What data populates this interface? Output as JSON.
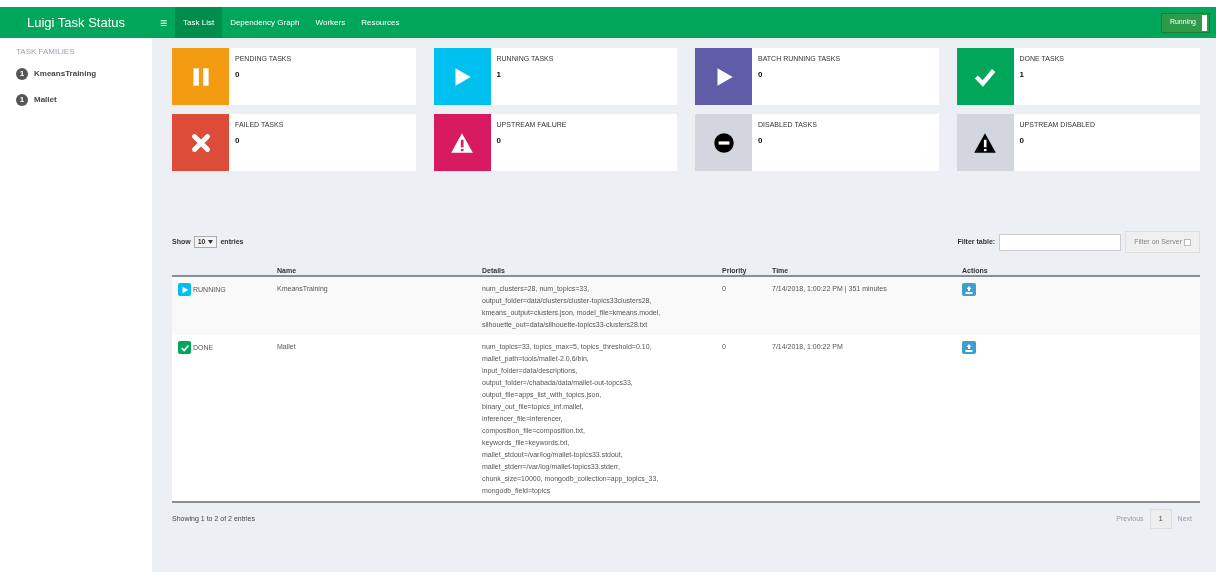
{
  "navbar": {
    "title": "Luigi Task Status",
    "menu_icon": "≡",
    "tabs": [
      {
        "label": "Task List",
        "selected": true
      },
      {
        "label": "Dependency Graph",
        "selected": false
      },
      {
        "label": "Workers",
        "selected": false
      },
      {
        "label": "Resources",
        "selected": false
      }
    ],
    "status_button": "Running"
  },
  "sidebar": {
    "heading": "TASK FAMILIES",
    "items": [
      {
        "count": "1",
        "label": "KmeansTraining"
      },
      {
        "count": "1",
        "label": "Mallet"
      }
    ]
  },
  "info_boxes": [
    {
      "kind": "pending",
      "label": "PENDING TASKS",
      "count": "0",
      "color": "#f39c12"
    },
    {
      "kind": "running",
      "label": "RUNNING TASKS",
      "count": "1",
      "color": "#00c0ef"
    },
    {
      "kind": "batch",
      "label": "BATCH RUNNING TASKS",
      "count": "0",
      "color": "#605ca8"
    },
    {
      "kind": "done",
      "label": "DONE TASKS",
      "count": "1",
      "color": "#00a65a"
    },
    {
      "kind": "failed",
      "label": "FAILED TASKS",
      "count": "0",
      "color": "#dd4b39"
    },
    {
      "kind": "upstream_failure",
      "label": "UPSTREAM FAILURE",
      "count": "0",
      "color": "#d81b60"
    },
    {
      "kind": "disabled",
      "label": "DISABLED TASKS",
      "count": "0",
      "color": "#d2d6de"
    },
    {
      "kind": "upstream_disabled",
      "label": "UPSTREAM DISABLED",
      "count": "0",
      "color": "#d2d6de"
    }
  ],
  "table_controls": {
    "show_label": "Show",
    "page_size": "10",
    "entries_label": "entries",
    "filter_label": "Filter table:",
    "filter_button": "Filter on Server",
    "server_filter_checked": false
  },
  "table": {
    "columns": [
      "Name",
      "Details",
      "Priority",
      "Time",
      "Actions"
    ],
    "rows": [
      {
        "kind": "running",
        "status": "RUNNING",
        "name": "KmeansTraining",
        "details_lines": [
          "num_clusters=28, num_topics=33,",
          "output_folder=data/clusters/cluster-topics33clusters28,",
          "kmeans_output=clusters.json, model_file=kmeans.model,",
          "silhouette_out=data/silhouette-topics33-clusters28.txt"
        ],
        "priority": "0",
        "time": "7/14/2018, 1:00:22 PM | 351 minutes"
      },
      {
        "kind": "done",
        "status": "DONE",
        "name": "Mallet",
        "details_lines": [
          "num_topics=33, topics_max=5, topics_threshold=0.10,",
          "mallet_path=tools/mallet-2.0.6/bin,",
          "input_folder=data/descriptions,",
          "output_folder=/chabada/data/mallet-out-topcs33,",
          "output_file=apps_list_with_topics.json,",
          "binary_out_file=topics_inf.mallet,",
          "inferencer_file=inferencer,",
          "composition_file=composition.txt,",
          "keywords_file=keywords.txt,",
          "mallet_stdout=/var/log/mallet-topics33.stdout,",
          "mallet_stderr=/var/log/mallet-topics33.stderr,",
          "chunk_size=10000, mongodb_collection=app_topics_33,",
          "mongodb_field=topics"
        ],
        "priority": "0",
        "time": "7/14/2018, 1:00:22 PM"
      }
    ]
  },
  "footer": {
    "summary": "Showing 1 to 2 of 2 entries",
    "previous": "Previous",
    "page": "1",
    "next": "Next"
  }
}
